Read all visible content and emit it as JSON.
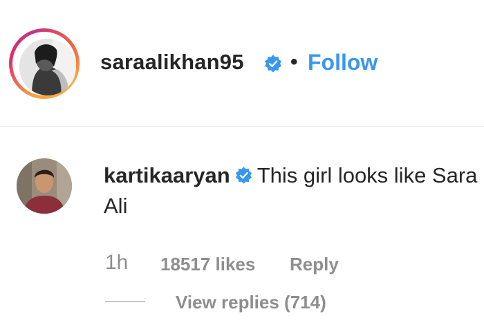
{
  "post_header": {
    "username": "saraalikhan95",
    "separator": "•",
    "follow_label": "Follow"
  },
  "comment": {
    "username": "kartikaaryan",
    "text": "This girl looks like Sara Ali",
    "time": "1h",
    "likes": "18517 likes",
    "reply_label": "Reply",
    "view_replies_label": "View replies (714)"
  },
  "colors": {
    "accent": "#3897f0",
    "verified": "#3897f0",
    "muted": "#8e8e8e",
    "text": "#262626"
  }
}
